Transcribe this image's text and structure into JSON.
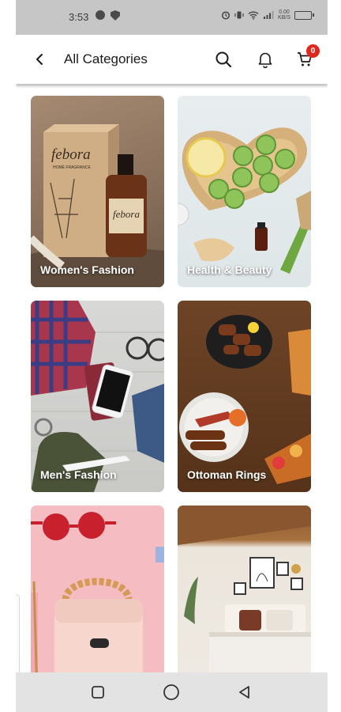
{
  "status_bar": {
    "time": "3:53",
    "speed_value": "0.00",
    "speed_unit": "KB/S"
  },
  "header": {
    "title": "All Categories",
    "cart_count": "0"
  },
  "categories": [
    {
      "label": "Women's Fashion"
    },
    {
      "label": "Health & Beauty"
    },
    {
      "label": "Men's Fashion"
    },
    {
      "label": "Ottoman Rings"
    },
    {
      "label": ""
    },
    {
      "label": ""
    }
  ],
  "product_labels": {
    "brand": "febora",
    "brand_sub": "HOME FRAGRANCE"
  },
  "icons": {
    "back": "chevron-left-icon",
    "search": "search-icon",
    "notifications": "bell-icon",
    "cart": "cart-icon",
    "nav_recents": "square-icon",
    "nav_home": "circle-icon",
    "nav_back": "triangle-back-icon"
  },
  "colors": {
    "status_bar_bg": "#c6c6c6",
    "badge": "#e1261c",
    "nav_bar_bg": "#e3e3e3"
  }
}
